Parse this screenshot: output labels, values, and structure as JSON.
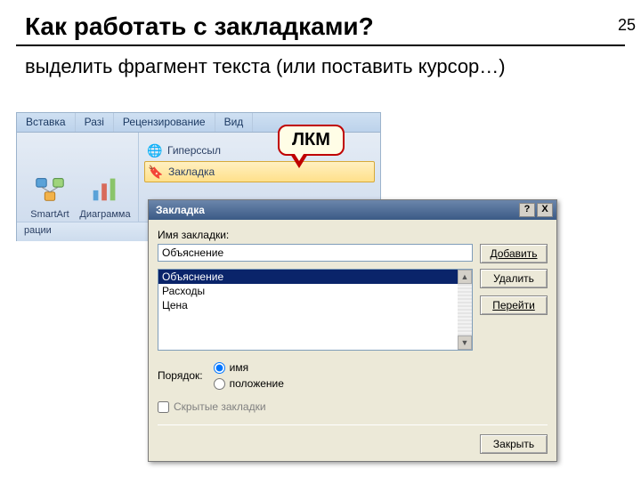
{
  "slide": {
    "number": "25"
  },
  "heading": "Как работать с закладками?",
  "subheading": "выделить фрагмент текста (или поставить курсор…)",
  "ribbon": {
    "tabs": [
      "Вставка",
      "Разі",
      "Рецензирование",
      "Вид"
    ],
    "buttons": {
      "smartart": "SmartArt",
      "diagram": "Диаграмма"
    },
    "links": {
      "hyperlink": "Гиперссыл",
      "bookmark": "Закладка"
    },
    "group": "рации"
  },
  "callout": {
    "text": "ЛКМ"
  },
  "dialog": {
    "title": "Закладка",
    "help_symbol": "?",
    "close_symbol": "X",
    "name_label": "Имя закладки:",
    "name_value": "Объяснение",
    "add_btn": "Добавить",
    "delete_btn": "Удалить",
    "goto_btn": "Перейти",
    "close_btn": "Закрыть",
    "list": [
      "Объяснение",
      "Расходы",
      "Цена"
    ],
    "order_label": "Порядок:",
    "order_name": "имя",
    "order_position": "положение",
    "hidden_label": "Скрытые закладки"
  }
}
